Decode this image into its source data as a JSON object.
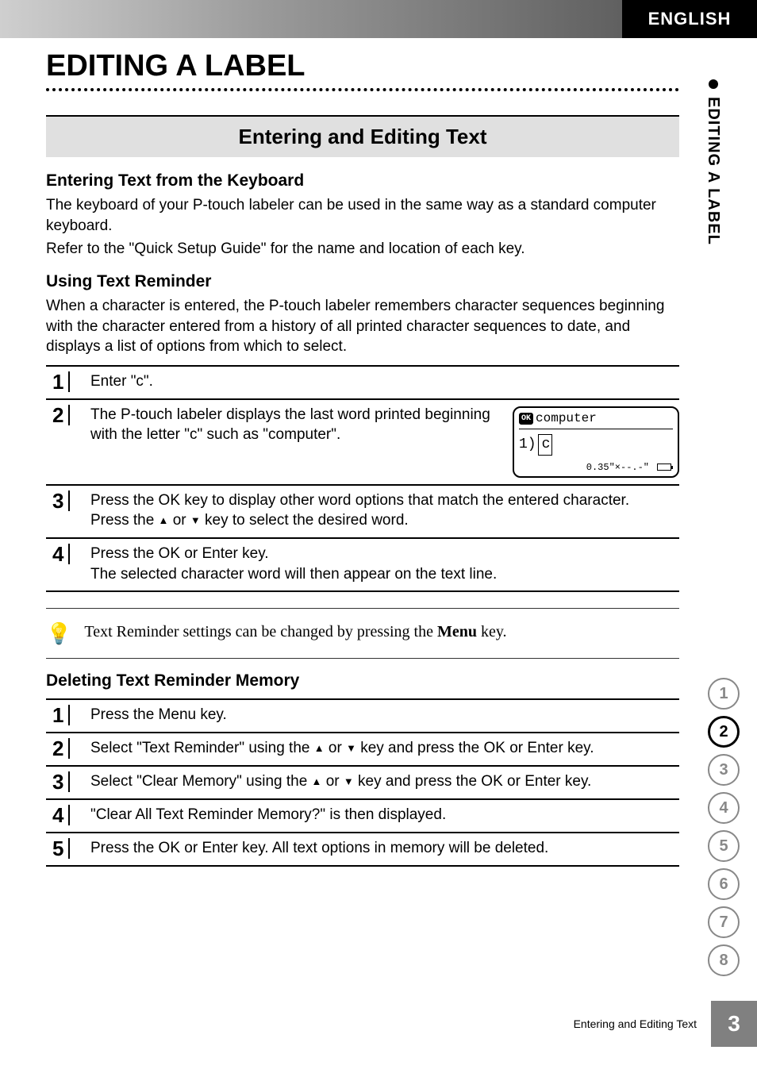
{
  "header": {
    "language": "ENGLISH",
    "chapter_title": "EDITING A LABEL",
    "vertical_tab": "EDITING A LABEL"
  },
  "section": {
    "title": "Entering and Editing Text"
  },
  "sub1": {
    "heading": "Entering Text from the Keyboard",
    "p1": "The keyboard of your P-touch labeler can be used in the same way as a standard computer keyboard.",
    "p2": "Refer to the \"Quick Setup Guide\" for the name and location of each key."
  },
  "sub2": {
    "heading": "Using Text Reminder",
    "intro": "When a character is entered, the P-touch labeler remembers character sequences beginning with the character entered from a history of all printed character sequences to date, and displays a list of options from which to select.",
    "steps": [
      {
        "n": "1",
        "text": "Enter \"c\"."
      },
      {
        "n": "2",
        "text": "The P-touch labeler displays the last word printed beginning with the letter \"c\" such as \"computer\"."
      },
      {
        "n": "3",
        "pre": "Press the ",
        "b1": "OK",
        "mid1": " key to display other word options that match the entered character.",
        "line2_pre": "Press the ",
        "line2_mid": " or ",
        "line2_post": " key to select the desired word."
      },
      {
        "n": "4",
        "pre": "Press the ",
        "b1": "OK",
        "mid1": " or ",
        "b2": "Enter",
        "mid2": " key.",
        "line2": "The selected character word will then appear on the text line."
      }
    ],
    "lcd": {
      "suggestion": "computer",
      "input": "c",
      "status": "0.35\"×--.-\""
    },
    "note_pre": "Text Reminder settings can be changed by pressing the ",
    "note_bold": "Menu",
    "note_post": " key."
  },
  "sub3": {
    "heading": "Deleting Text Reminder Memory",
    "steps": [
      {
        "n": "1",
        "pre": "Press the ",
        "b1": "Menu",
        "post": " key."
      },
      {
        "n": "2",
        "pre": "Select \"Text Reminder\" using the ",
        "mid": " or ",
        "post": " key and press the ",
        "b1": "OK",
        "mid2": " or ",
        "b2": "Enter",
        "post2": " key."
      },
      {
        "n": "3",
        "pre": "Select \"Clear Memory\" using the ",
        "mid": " or ",
        "post": " key and press the ",
        "b1": "OK",
        "mid2": " or ",
        "b2": "Enter",
        "post2": " key."
      },
      {
        "n": "4",
        "text": "\"Clear All Text Reminder Memory?\" is then displayed."
      },
      {
        "n": "5",
        "pre": "Press the ",
        "b1": "OK",
        "mid": " or ",
        "b2": "Enter",
        "post": " key. All text options in memory will be deleted."
      }
    ]
  },
  "nav": {
    "items": [
      "1",
      "2",
      "3",
      "4",
      "5",
      "6",
      "7",
      "8"
    ],
    "active": "2"
  },
  "footer": {
    "text": "Entering and Editing Text",
    "page": "3"
  }
}
